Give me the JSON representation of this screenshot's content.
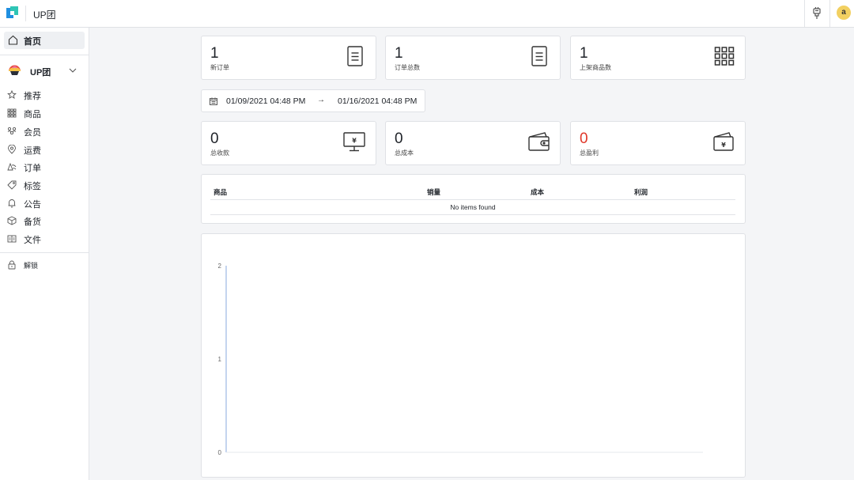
{
  "app": {
    "title": "UP团"
  },
  "topbar": {
    "avatar_initial": "a",
    "plugin_icon": "plug-icon"
  },
  "sidebar": {
    "home_label": "首页",
    "org_name": "UP团",
    "items": [
      {
        "label": "推荐",
        "icon": "star-icon"
      },
      {
        "label": "商品",
        "icon": "grid-icon"
      },
      {
        "label": "会员",
        "icon": "members-icon"
      },
      {
        "label": "运费",
        "icon": "location-icon"
      },
      {
        "label": "订单",
        "icon": "order-icon"
      },
      {
        "label": "标签",
        "icon": "tag-icon"
      },
      {
        "label": "公告",
        "icon": "bell-icon"
      },
      {
        "label": "备货",
        "icon": "box-icon"
      },
      {
        "label": "文件",
        "icon": "file-icon"
      }
    ],
    "unlock_label": "解锁"
  },
  "stats_top": [
    {
      "value": "1",
      "caption": "新订单",
      "icon": "document-icon"
    },
    {
      "value": "1",
      "caption": "订单总数",
      "icon": "document-icon"
    },
    {
      "value": "1",
      "caption": "上架商品数",
      "icon": "grid-icon"
    }
  ],
  "date_range": {
    "start": "01/09/2021 04:48 PM",
    "arrow": "→",
    "end": "01/16/2021 04:48 PM"
  },
  "stats_bottom": [
    {
      "value": "0",
      "caption": "总收款",
      "icon": "monitor-yen-icon"
    },
    {
      "value": "0",
      "caption": "总成本",
      "icon": "wallet-icon"
    },
    {
      "value": "0",
      "caption": "总盈利",
      "icon": "wallet-yen-icon",
      "color": "#e0382a"
    }
  ],
  "table": {
    "headers": [
      "商品",
      "销量",
      "成本",
      "利润"
    ],
    "empty_text": "No items found"
  },
  "chart_data": {
    "type": "line",
    "title": "",
    "xlabel": "",
    "ylabel": "",
    "yticks": [
      "2",
      "1",
      "0"
    ],
    "ylim": [
      0,
      2
    ],
    "series": [],
    "grid": false,
    "axis_color": "#9db8e4"
  }
}
